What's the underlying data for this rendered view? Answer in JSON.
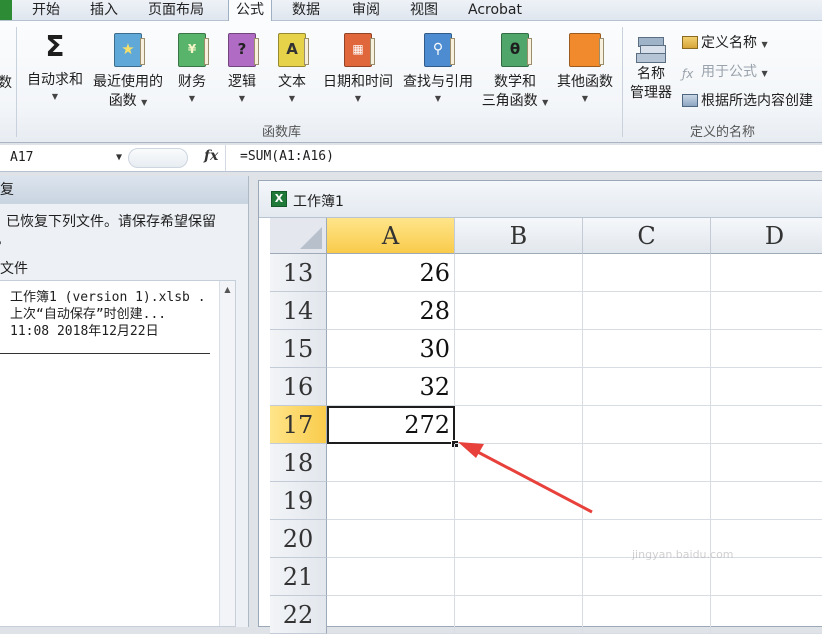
{
  "tabs": [
    {
      "label": "开始",
      "active": false
    },
    {
      "label": "插入",
      "active": false
    },
    {
      "label": "页面布局",
      "active": false
    },
    {
      "label": "公式",
      "active": true
    },
    {
      "label": "数据",
      "active": false
    },
    {
      "label": "审阅",
      "active": false
    },
    {
      "label": "视图",
      "active": false
    },
    {
      "label": "Acrobat",
      "active": false
    }
  ],
  "ribbon": {
    "partial_left_label": "数",
    "function_library": {
      "group_label": "函数库",
      "autosum": "自动求和",
      "recent": [
        "最近使用的",
        "函数"
      ],
      "financial": "财务",
      "logical": "逻辑",
      "text": "文本",
      "datetime": "日期和时间",
      "lookup": "查找与引用",
      "math": [
        "数学和",
        "三角函数"
      ],
      "more": "其他函数"
    },
    "defined_names": {
      "group_label": "定义的名称",
      "name_manager": [
        "名称",
        "管理器"
      ],
      "define_name": "定义名称",
      "use_in_formula": "用于公式",
      "create_from_selection": "根据所选内容创建"
    },
    "book_colors": {
      "recent": "#5fa8d8",
      "financial": "#58b46b",
      "logical": "#b06bc4",
      "text": "#e6d34a",
      "datetime": "#e0673c",
      "lookup": "#4d8cd0",
      "math": "#4fa56a",
      "more": "#f08a2c"
    }
  },
  "formula_bar": {
    "name_box": "A17",
    "fx": "fx",
    "formula": "=SUM(A1:A16)"
  },
  "recovery_pane": {
    "title": "复",
    "message_line1": "已恢复下列文件。请保存希望保留",
    "message_line2": "。",
    "section_label": "文件",
    "file_name": "工作簿1 (version 1).xlsb .",
    "file_status": "上次“自动保存”时创建...",
    "file_time": "11:08 2018年12月22日"
  },
  "workbook": {
    "title": "工作簿1",
    "columns": [
      "A",
      "B",
      "C",
      "D"
    ],
    "selected_column": "A",
    "rows": [
      {
        "num": "13",
        "a": "26"
      },
      {
        "num": "14",
        "a": "28"
      },
      {
        "num": "15",
        "a": "30"
      },
      {
        "num": "16",
        "a": "32"
      },
      {
        "num": "17",
        "a": "272"
      },
      {
        "num": "18",
        "a": ""
      },
      {
        "num": "19",
        "a": ""
      },
      {
        "num": "20",
        "a": ""
      },
      {
        "num": "21",
        "a": ""
      },
      {
        "num": "22",
        "a": ""
      }
    ],
    "active_row": "17",
    "arrow_color": "#e8403a"
  },
  "watermark": "jingyan.baidu.com"
}
